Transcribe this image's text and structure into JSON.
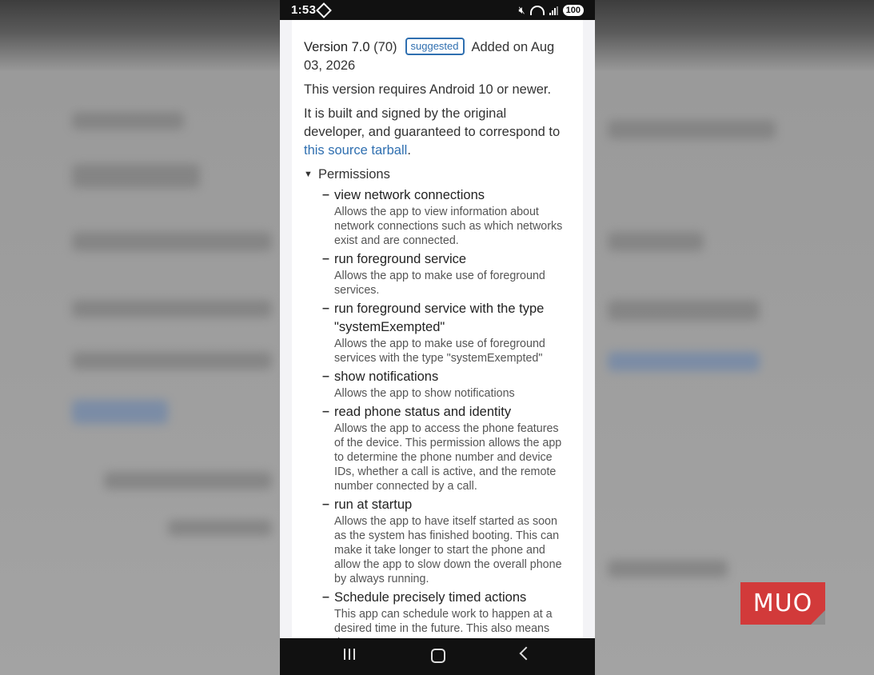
{
  "status": {
    "time": "1:53",
    "battery": "100"
  },
  "version": {
    "label": "Version 7.0",
    "code": "(70)",
    "badge": "suggested",
    "added": "Added on Aug",
    "added_cont": "03, 2026"
  },
  "requirement": "This version requires Android 10 or newer.",
  "built": {
    "text": "It is built and signed by the original developer, and guaranteed to correspond to ",
    "link": "this source tarball",
    "end": "."
  },
  "permissions_header": "Permissions",
  "permissions": [
    {
      "title": "view network connections",
      "desc": "Allows the app to view information about network connections such as which networks exist and are connected."
    },
    {
      "title": "run foreground service",
      "desc": "Allows the app to make use of foreground services."
    },
    {
      "title": "run foreground service with the type \"systemExempted\"",
      "desc": "Allows the app to make use of foreground services with the type \"systemExempted\""
    },
    {
      "title": "show notifications",
      "desc": "Allows the app to show notifications"
    },
    {
      "title": "read phone status and identity",
      "desc": "Allows the app to access the phone features of the device. This permission allows the app to determine the phone number and device IDs, whether a call is active, and the remote number connected by a call."
    },
    {
      "title": "run at startup",
      "desc": "Allows the app to have itself started as soon as the system has finished booting. This can make it take longer to start the phone and allow the app to slow down the overall phone by always running."
    },
    {
      "title": "Schedule precisely timed actions",
      "desc": "This app can schedule work to happen at a desired time in the future. This also means that"
    }
  ],
  "watermark": "MUO",
  "colors": {
    "link": "#2f6fb0",
    "logo": "#d23a3a"
  }
}
